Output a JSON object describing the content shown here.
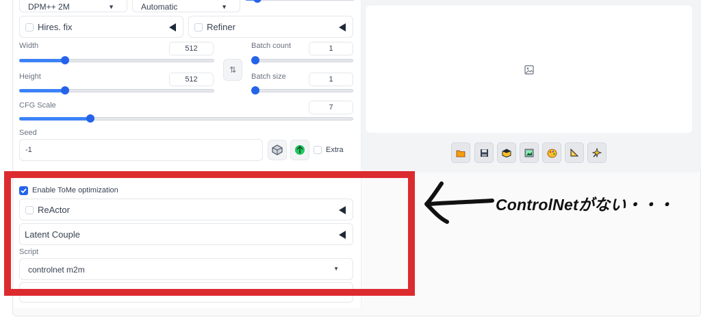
{
  "top": {
    "sampler_value": "DPM++ 2M",
    "schedule_value": "Automatic"
  },
  "accordions": {
    "hires_fix": "Hires. fix",
    "refiner": "Refiner"
  },
  "sliders": {
    "width": {
      "label": "Width",
      "value": "512",
      "fraction": 0.23
    },
    "height": {
      "label": "Height",
      "value": "512",
      "fraction": 0.23
    },
    "batch_count": {
      "label": "Batch count",
      "value": "1",
      "fraction": 0.0
    },
    "batch_size": {
      "label": "Batch size",
      "value": "1",
      "fraction": 0.0
    },
    "cfg_scale": {
      "label": "CFG Scale",
      "value": "7",
      "fraction": 0.21
    }
  },
  "swap_glyph": "⇅",
  "seed": {
    "label": "Seed",
    "value": "-1",
    "extra_label": "Extra"
  },
  "extensions": {
    "tome_label": "Enable ToMe optimization",
    "reactor_label": "ReActor",
    "latent_couple_label": "Latent Couple",
    "script_label": "Script",
    "script_value": "controlnet m2m"
  },
  "annotation": {
    "text": "ControlNetがない・・・"
  },
  "icons": [
    "image-placeholder-icon",
    "open-folder-icon",
    "save-icon",
    "zip-icon",
    "send-to-img2img-icon",
    "send-to-inpaint-icon",
    "send-to-extras-icon",
    "sparkle-icon",
    "dice-icon",
    "recycle-icon"
  ],
  "colors": {
    "accent": "#2563eb",
    "annotation_box": "#dc2b2f"
  }
}
